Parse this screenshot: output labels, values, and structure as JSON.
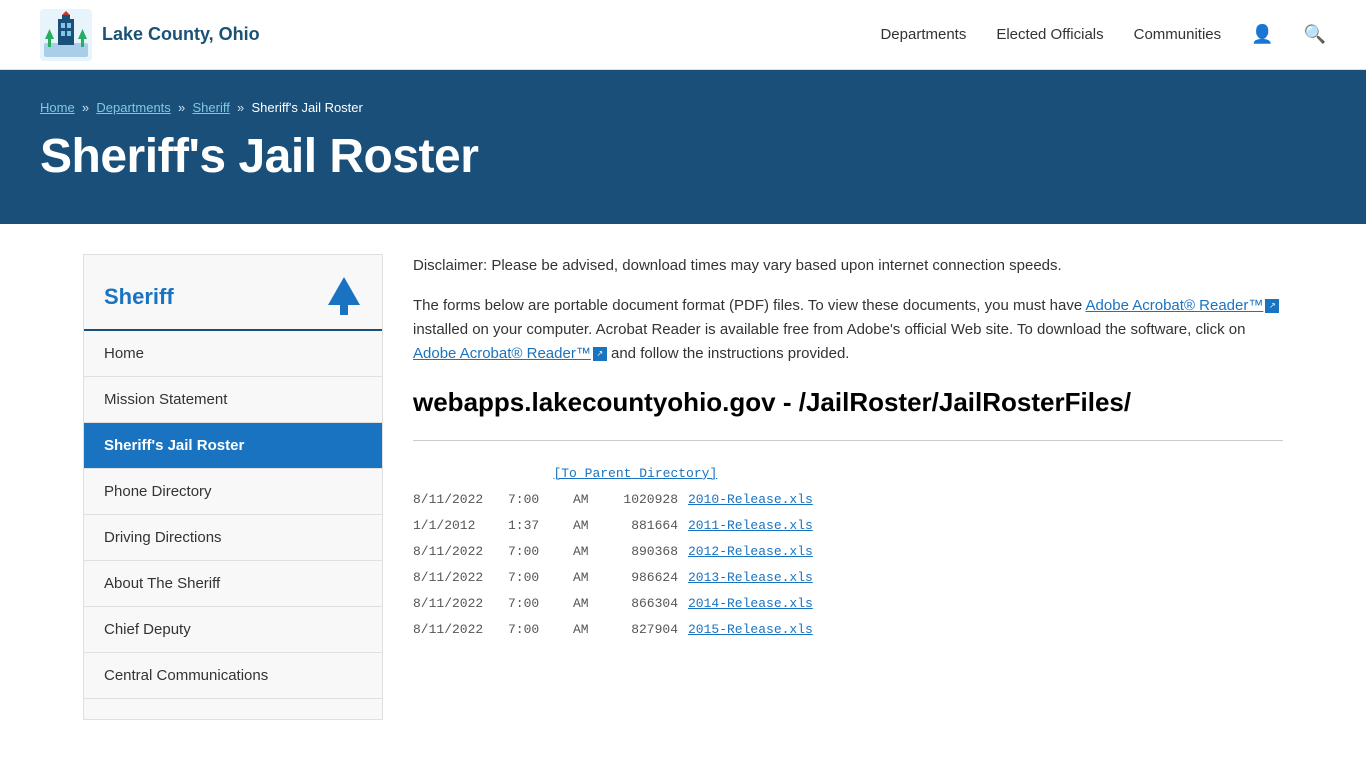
{
  "header": {
    "logo_text": "Lake County, Ohio",
    "nav_items": [
      {
        "label": "Departments",
        "id": "departments"
      },
      {
        "label": "Elected Officials",
        "id": "elected-officials"
      },
      {
        "label": "Communities",
        "id": "communities"
      }
    ]
  },
  "breadcrumb": {
    "items": [
      {
        "label": "Home",
        "href": "#"
      },
      {
        "label": "Departments",
        "href": "#"
      },
      {
        "label": "Sheriff",
        "href": "#"
      }
    ],
    "current": "Sheriff's Jail Roster"
  },
  "hero": {
    "title": "Sheriff's Jail Roster"
  },
  "sidebar": {
    "title": "Sheriff",
    "nav_items": [
      {
        "label": "Home",
        "id": "home",
        "active": false
      },
      {
        "label": "Mission Statement",
        "id": "mission-statement",
        "active": false
      },
      {
        "label": "Sheriff's Jail Roster",
        "id": "sheriffs-jail-roster",
        "active": true
      },
      {
        "label": "Phone Directory",
        "id": "phone-directory",
        "active": false
      },
      {
        "label": "Driving Directions",
        "id": "driving-directions",
        "active": false
      },
      {
        "label": "About The Sheriff",
        "id": "about-the-sheriff",
        "active": false
      },
      {
        "label": "Chief Deputy",
        "id": "chief-deputy",
        "active": false
      },
      {
        "label": "Central Communications",
        "id": "central-communications",
        "active": false
      }
    ]
  },
  "content": {
    "disclaimer": "Disclaimer: Please be advised, download times may vary based upon internet connection speeds.",
    "para1_before_link1": "The forms below are portable document format (PDF) files. To view these documents, you must have ",
    "link1_text": "Adobe Acrobat® Reader™",
    "para1_middle": " installed on your computer. Acrobat Reader is available free from Adobe's official Web site. To download the software, click on ",
    "link2_text": "Adobe Acrobat® Reader™",
    "para1_after": " and follow the instructions provided.",
    "file_listing_title": "webapps.lakecountyohio.gov - /JailRoster/JailRosterFiles/",
    "parent_dir_label": "[To Parent Directory]",
    "files": [
      {
        "date": "8/11/2022",
        "time": "7:00",
        "ampm": "AM",
        "size": "1020928",
        "name": "2010-Release.xls"
      },
      {
        "date": "1/1/2012",
        "time": "1:37",
        "ampm": "AM",
        "size": "881664",
        "name": "2011-Release.xls"
      },
      {
        "date": "8/11/2022",
        "time": "7:00",
        "ampm": "AM",
        "size": "890368",
        "name": "2012-Release.xls"
      },
      {
        "date": "8/11/2022",
        "time": "7:00",
        "ampm": "AM",
        "size": "986624",
        "name": "2013-Release.xls"
      },
      {
        "date": "8/11/2022",
        "time": "7:00",
        "ampm": "AM",
        "size": "866304",
        "name": "2014-Release.xls"
      },
      {
        "date": "8/11/2022",
        "time": "7:00",
        "ampm": "AM",
        "size": "827904",
        "name": "2015-Release.xls"
      }
    ]
  }
}
